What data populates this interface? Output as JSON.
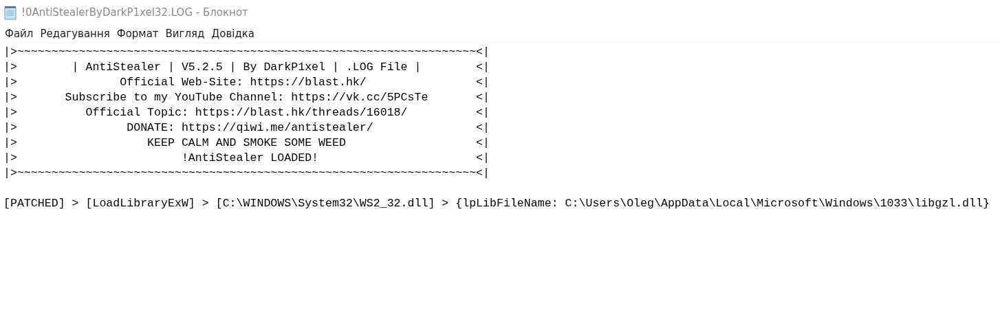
{
  "window": {
    "title": "!0AntiStealerByDarkP1xel32.LOG - Блокнот"
  },
  "menu": [
    "Файл",
    "Редагування",
    "Формат",
    "Вигляд",
    "Довідка"
  ],
  "document": {
    "lines": [
      "|>~~~~~~~~~~~~~~~~~~~~~~~~~~~~~~~~~~~~~~~~~~~~~~~~~~~~~~~~~~~~~~~~~~~<|",
      "|>        | AntiStealer | V5.2.5 | By DarkP1xel | .LOG File |        <|",
      "|>               Official Web-Site: https://blast.hk/                <|",
      "|>       Subscribe to my YouTube Channel: https://vk.cc/5PCsTe       <|",
      "|>          Official Topic: https://blast.hk/threads/16018/          <|",
      "|>                DONATE: https://qiwi.me/antistealer/               <|",
      "|>                   KEEP CALM AND SMOKE SOME WEED                   <|",
      "|>                        !AntiStealer LOADED!                       <|",
      "|>~~~~~~~~~~~~~~~~~~~~~~~~~~~~~~~~~~~~~~~~~~~~~~~~~~~~~~~~~~~~~~~~~~~<|"
    ],
    "log_lines": [
      "[PATCHED] > [LoadLibraryExW] > [C:\\WINDOWS\\System32\\WS2_32.dll] > {lpLibFileName: C:\\Users\\Oleg\\AppData\\Local\\Microsoft\\Windows\\1033\\libgzl.dll}"
    ]
  }
}
